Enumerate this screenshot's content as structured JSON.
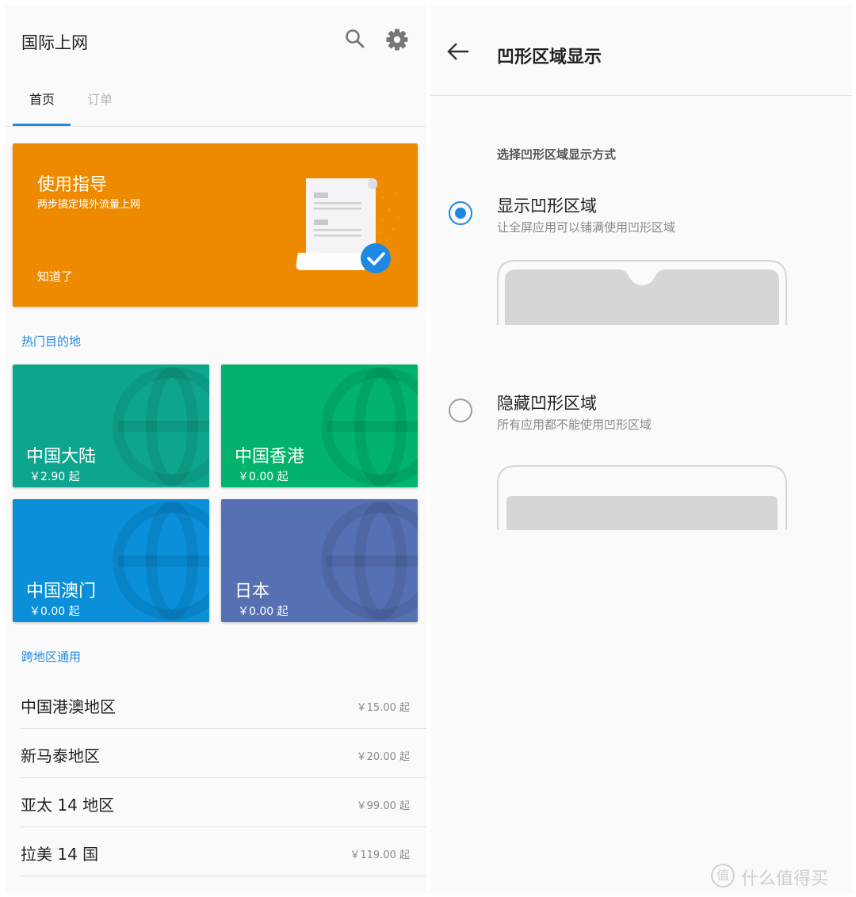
{
  "left": {
    "app_title": "国际上网",
    "icons": {
      "search": "search-icon",
      "settings": "gear-icon"
    },
    "tabs": [
      {
        "label": "首页",
        "active": true
      },
      {
        "label": "订单",
        "active": false
      }
    ],
    "guide": {
      "title": "使用指导",
      "subtitle": "两步搞定境外流量上网",
      "button": "知道了",
      "color": "#ee8a00"
    },
    "popular": {
      "label": "热门目的地",
      "items": [
        {
          "name": "中国大陆",
          "price": "￥2.90 起",
          "color": "#0ea58f"
        },
        {
          "name": "中国香港",
          "price": "￥0.00 起",
          "color": "#02b36b"
        },
        {
          "name": "中国澳门",
          "price": "￥0.00 起",
          "color": "#0a8fd8"
        },
        {
          "name": "日本",
          "price": "￥0.00 起",
          "color": "#5670b4"
        }
      ]
    },
    "regional": {
      "label": "跨地区通用",
      "items": [
        {
          "name": "中国港澳地区",
          "price": "￥15.00 起"
        },
        {
          "name": "新马泰地区",
          "price": "￥20.00 起"
        },
        {
          "name": "亚太 14 地区",
          "price": "￥99.00 起"
        },
        {
          "name": "拉美 14 国",
          "price": "￥119.00 起"
        }
      ]
    },
    "accent": "#1e88e5"
  },
  "right": {
    "title": "凹形区域显示",
    "section": "选择凹形区域显示方式",
    "options": [
      {
        "title": "显示凹形区域",
        "subtitle": "让全屏应用可以铺满使用凹形区域",
        "selected": true
      },
      {
        "title": "隐藏凹形区域",
        "subtitle": "所有应用都不能使用凹形区域",
        "selected": false
      }
    ]
  },
  "watermark": {
    "badge": "值",
    "text": "什么值得买"
  }
}
